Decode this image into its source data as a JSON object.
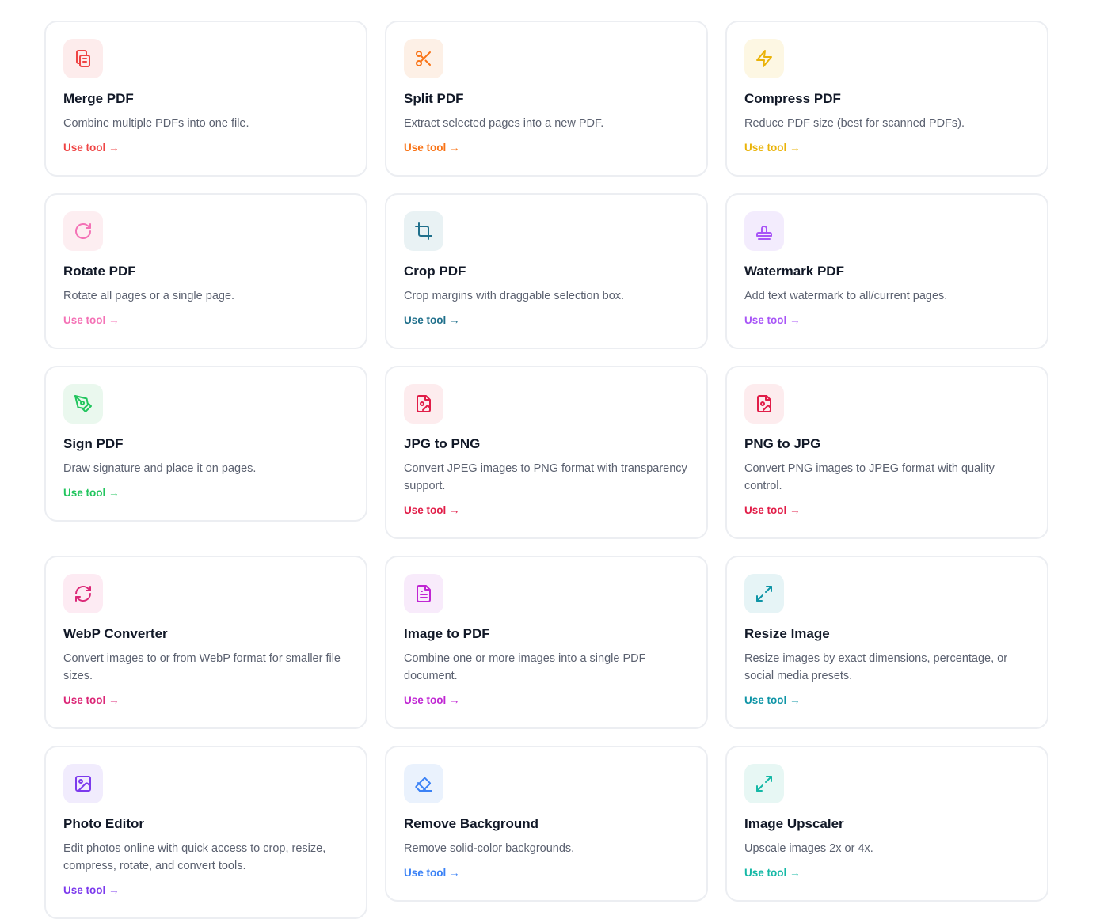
{
  "tools": [
    {
      "title": "Merge PDF",
      "desc": "Combine multiple PDFs into one file.",
      "link": "Use tool →",
      "icon": "copy-icon",
      "color": "#ef4444",
      "bg": "#fdecec"
    },
    {
      "title": "Split PDF",
      "desc": "Extract selected pages into a new PDF.",
      "link": "Use tool →",
      "icon": "scissors-icon",
      "color": "#f97316",
      "bg": "#fdf0e6"
    },
    {
      "title": "Compress PDF",
      "desc": "Reduce PDF size (best for scanned PDFs).",
      "link": "Use tool →",
      "icon": "zap-icon",
      "color": "#eab308",
      "bg": "#fdf7e3"
    },
    {
      "title": "Rotate PDF",
      "desc": "Rotate all pages or a single page.",
      "link": "Use tool →",
      "icon": "rotate-icon",
      "color": "#f472b6",
      "bg": "#fdeef1"
    },
    {
      "title": "Crop PDF",
      "desc": "Crop margins with draggable selection box.",
      "link": "Use tool →",
      "icon": "crop-icon",
      "color": "#1f6f8b",
      "bg": "#e9f2f4"
    },
    {
      "title": "Watermark PDF",
      "desc": "Add text watermark to all/current pages.",
      "link": "Use tool →",
      "icon": "stamp-icon",
      "color": "#a855f7",
      "bg": "#f3ecfd"
    },
    {
      "title": "Sign PDF",
      "desc": "Draw signature and place it on pages.",
      "link": "Use tool →",
      "icon": "pen-tool-icon",
      "color": "#22c55e",
      "bg": "#eaf8ee"
    },
    {
      "title": "JPG to PNG",
      "desc": "Convert JPEG images to PNG format with transparency support.",
      "link": "Use tool →",
      "icon": "file-image-icon",
      "color": "#e11d48",
      "bg": "#fdecee"
    },
    {
      "title": "PNG to JPG",
      "desc": "Convert PNG images to JPEG format with quality control.",
      "link": "Use tool →",
      "icon": "file-image-icon",
      "color": "#e11d48",
      "bg": "#fdecee"
    },
    {
      "title": "WebP Converter",
      "desc": "Convert images to or from WebP format for smaller file sizes.",
      "link": "Use tool →",
      "icon": "refresh-icon",
      "color": "#db2777",
      "bg": "#fdebf3"
    },
    {
      "title": "Image to PDF",
      "desc": "Combine one or more images into a single PDF document.",
      "link": "Use tool →",
      "icon": "file-text-icon",
      "color": "#c026d3",
      "bg": "#f8ebfb"
    },
    {
      "title": "Resize Image",
      "desc": "Resize images by exact dimensions, percentage, or social media presets.",
      "link": "Use tool →",
      "icon": "maximize-icon",
      "color": "#0e94a6",
      "bg": "#e6f4f6"
    },
    {
      "title": "Photo Editor",
      "desc": "Edit photos online with quick access to crop, resize, compress, rotate, and convert tools.",
      "link": "Use tool →",
      "icon": "image-icon",
      "color": "#7c3aed",
      "bg": "#f1ecfd"
    },
    {
      "title": "Remove Background",
      "desc": "Remove solid-color backgrounds.",
      "link": "Use tool →",
      "icon": "eraser-icon",
      "color": "#3b82f6",
      "bg": "#eaf2fd"
    },
    {
      "title": "Image Upscaler",
      "desc": "Upscale images 2x or 4x.",
      "link": "Use tool →",
      "icon": "expand-icon",
      "color": "#14b8a6",
      "bg": "#e7f7f4"
    }
  ]
}
